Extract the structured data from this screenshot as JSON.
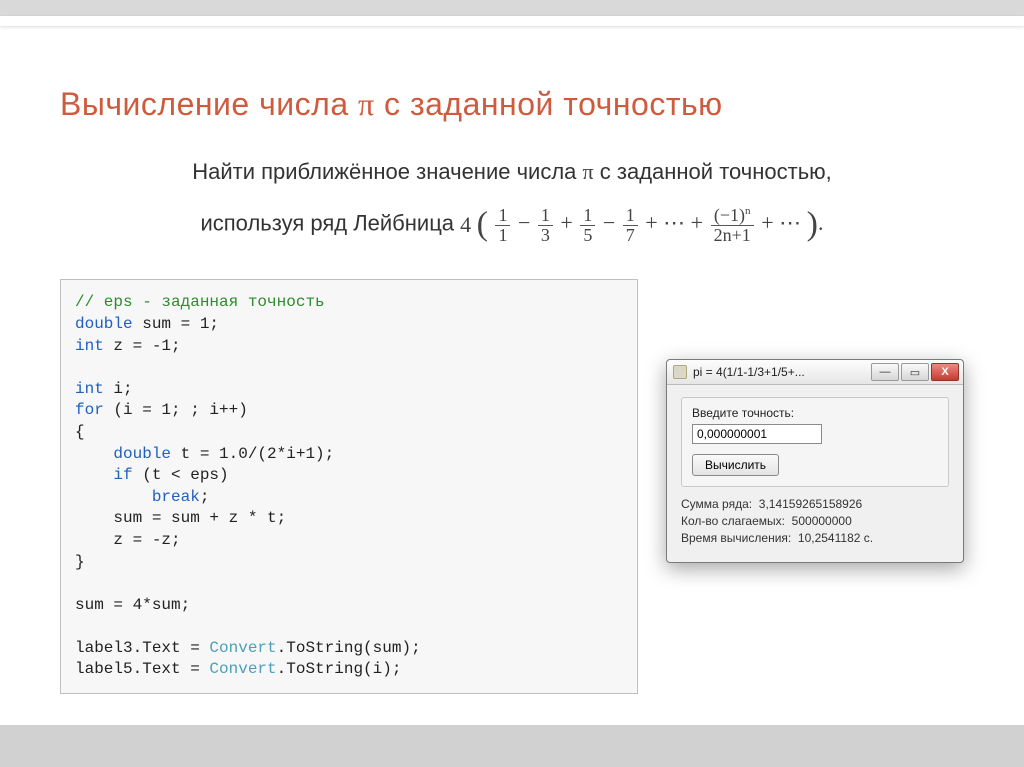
{
  "title_prefix": "Вычисление числа ",
  "title_suffix": " с заданной точностью",
  "pi_symbol": "π",
  "desc_line1_prefix": "Найти приближённое значение числа ",
  "desc_line1_suffix": " с заданной точностью,",
  "desc_line2_prefix": "используя ряд Лейбница ",
  "formula": {
    "lead": "4",
    "f1n": "1",
    "f1d": "1",
    "f2n": "1",
    "f2d": "3",
    "f3n": "1",
    "f3d": "5",
    "f4n": "1",
    "f4d": "7",
    "dots": "⋯",
    "gn_num": "(−1)",
    "gn_sup": "n",
    "gn_den": "2n+1",
    "period": "."
  },
  "code": {
    "l1": "// eps - заданная точность",
    "l2a": "double",
    "l2b": " sum = 1;",
    "l3a": "int",
    "l3b": " z = -1;",
    "l4": "",
    "l5a": "int",
    "l5b": " i;",
    "l6a": "for",
    "l6b": " (i = 1; ; i++)",
    "l7": "{",
    "l8a": "    double",
    "l8b": " t = 1.0/(2*i+1);",
    "l9a": "    if",
    "l9b": " (t < eps)",
    "l10a": "        break",
    "l10b": ";",
    "l11": "    sum = sum + z * t;",
    "l12": "    z = -z;",
    "l13": "}",
    "l14": "",
    "l15": "sum = 4*sum;",
    "l16": "",
    "l17a": "label3.Text = ",
    "l17b": "Convert",
    "l17c": ".ToString(sum);",
    "l18a": "label5.Text = ",
    "l18b": "Convert",
    "l18c": ".ToString(i);"
  },
  "window": {
    "title": "pi = 4(1/1-1/3+1/5+...",
    "min": "—",
    "max": "▭",
    "close": "Х",
    "inputLabel": "Введите точность:",
    "inputValue": "0,000000001",
    "button": "Вычислить",
    "res1label": "Сумма ряда:",
    "res1val": "3,14159265158926",
    "res2label": "Кол-во слагаемых:",
    "res2val": "500000000",
    "res3label": "Время вычисления:",
    "res3val": "10,2541182 с."
  }
}
